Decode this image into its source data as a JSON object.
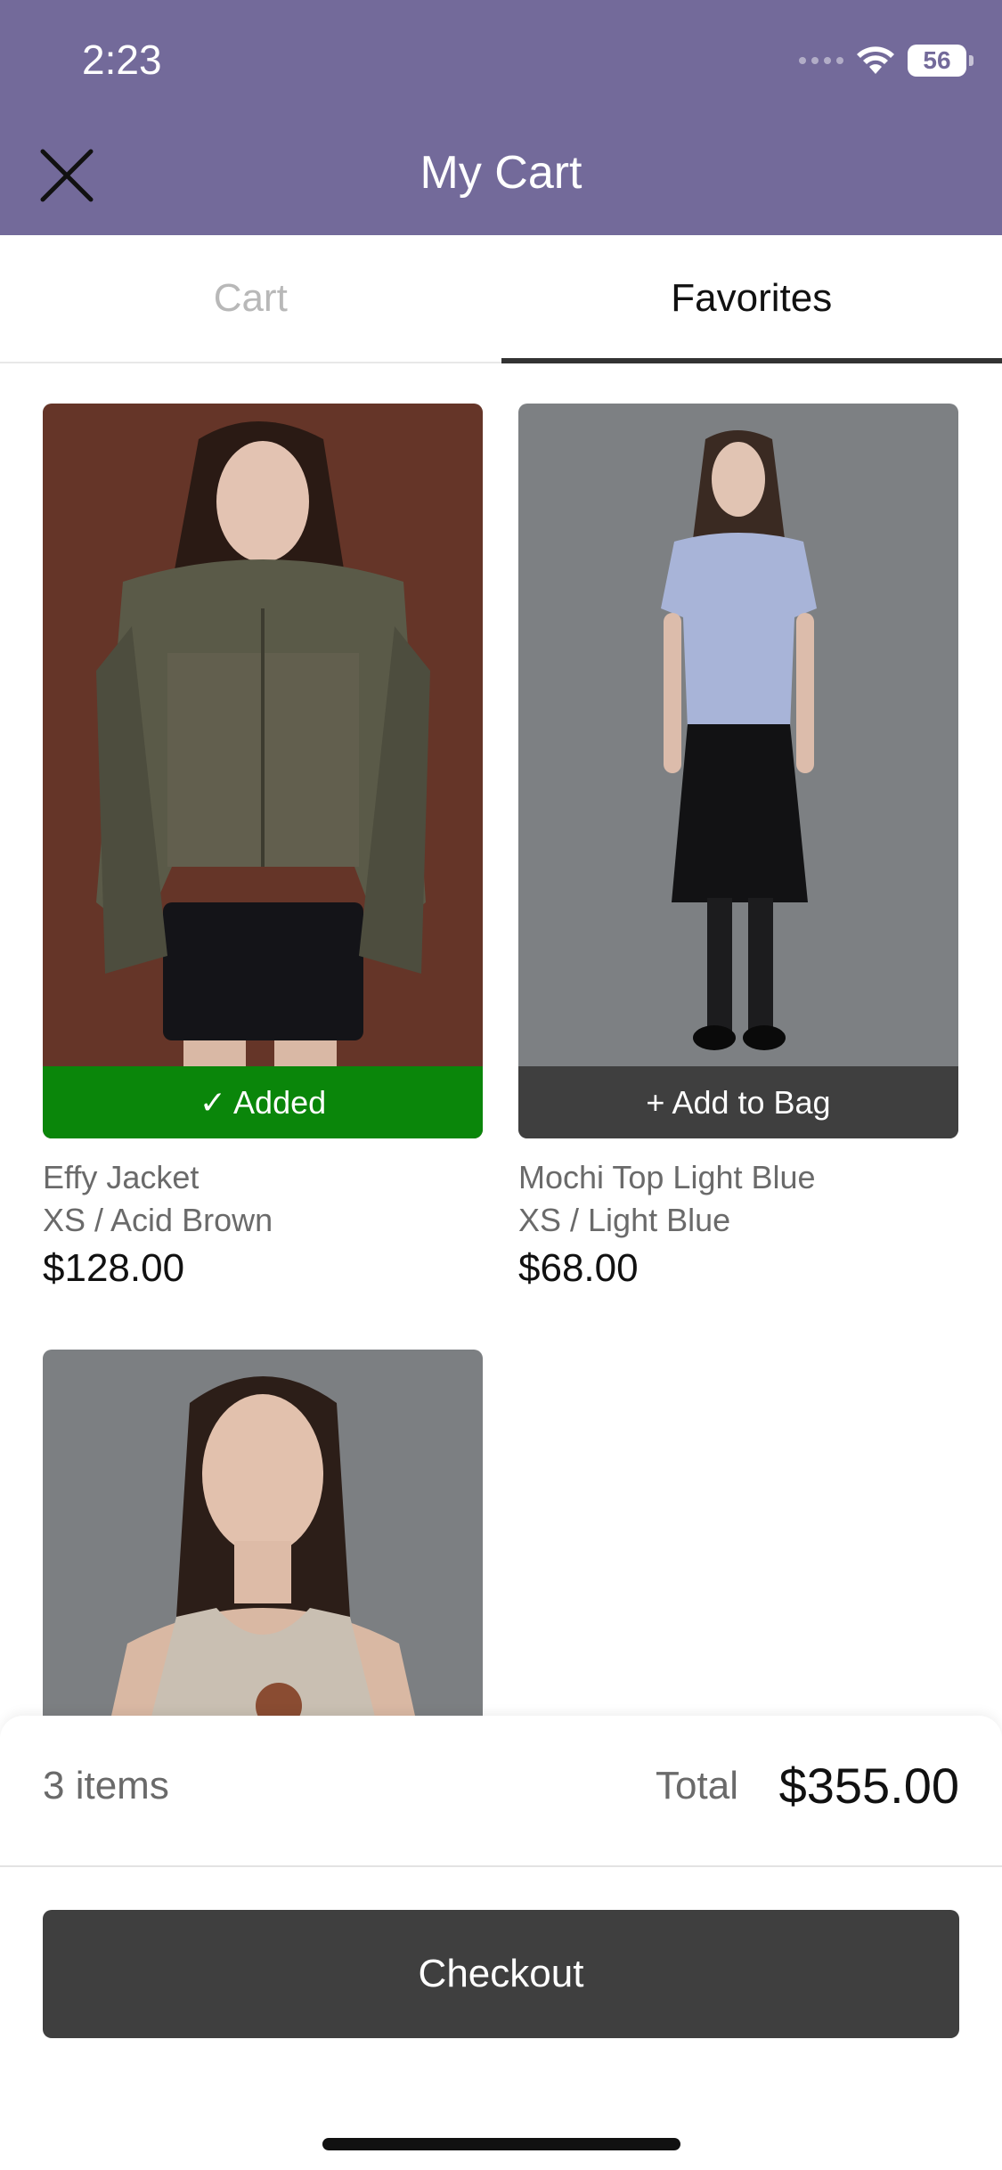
{
  "status_bar": {
    "time": "2:23",
    "battery": "56"
  },
  "header": {
    "title": "My Cart",
    "close_icon": "close-icon"
  },
  "tabs": [
    {
      "label": "Cart",
      "active": false
    },
    {
      "label": "Favorites",
      "active": true
    }
  ],
  "products": [
    {
      "name": "Effy Jacket",
      "variant": "XS / Acid Brown",
      "price": "$128.00",
      "button": "✓ Added",
      "state": "added"
    },
    {
      "name": "Mochi Top Light Blue",
      "variant": "XS / Light Blue",
      "price": "$68.00",
      "button": "+ Add to Bag",
      "state": "not_added"
    }
  ],
  "summary": {
    "items_count": "3 items",
    "total_label": "Total",
    "total_value": "$355.00"
  },
  "checkout": {
    "label": "Checkout"
  },
  "colors": {
    "header": "#736a9a",
    "added": "#0a860a",
    "dark_button": "#3f3f3f"
  }
}
